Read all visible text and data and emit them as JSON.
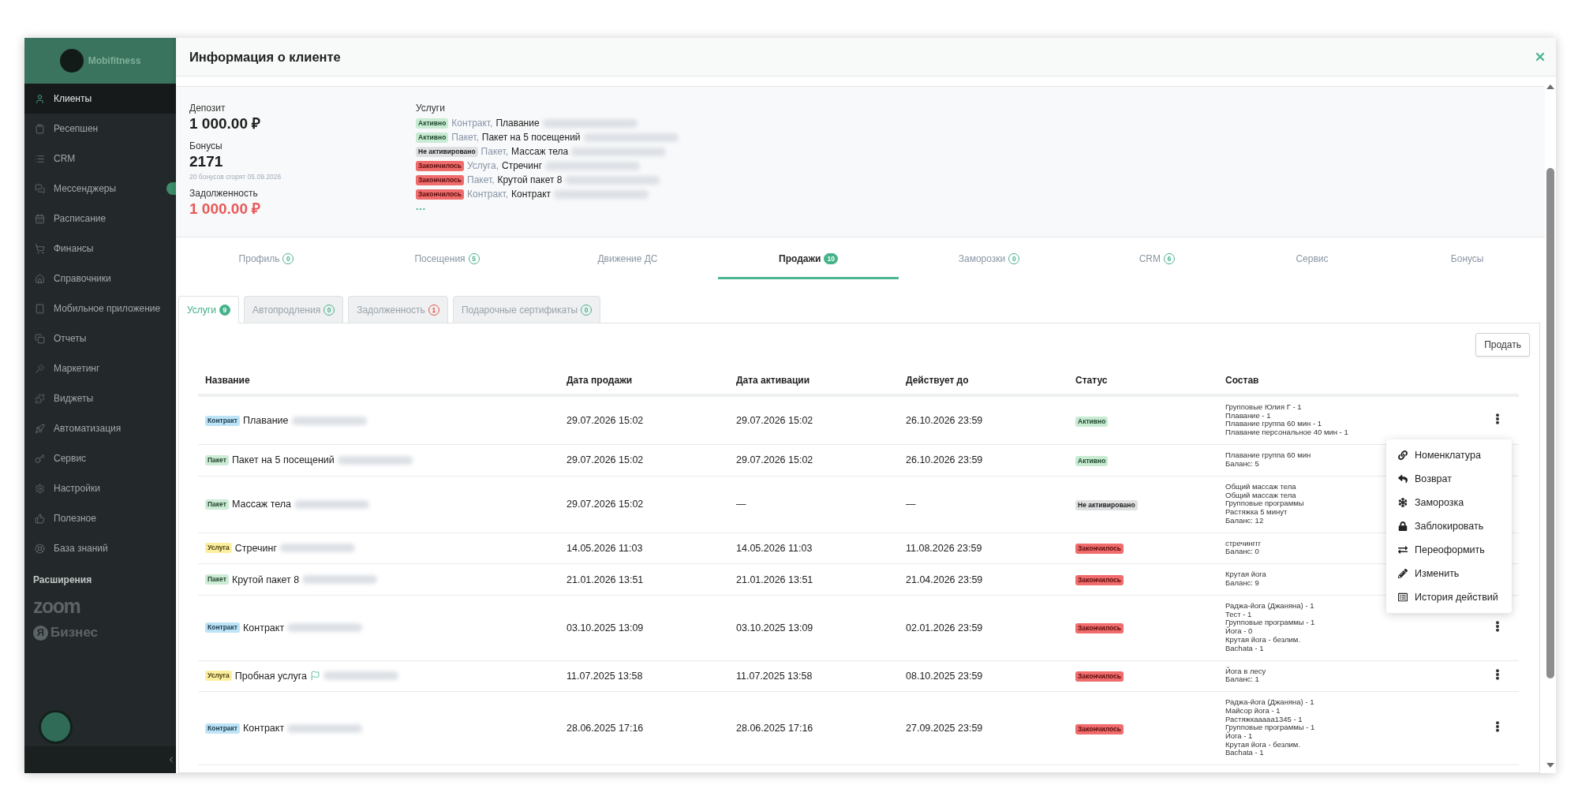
{
  "sidebar": {
    "logo": "Mobifitness",
    "items": [
      {
        "label": "Клиенты",
        "selected": true,
        "badge": false
      },
      {
        "label": "Ресепшен",
        "selected": false,
        "badge": false
      },
      {
        "label": "CRM",
        "selected": false,
        "badge": false
      },
      {
        "label": "Мессенджеры",
        "selected": false,
        "badge": true
      },
      {
        "label": "Расписание",
        "selected": false,
        "badge": false
      },
      {
        "label": "Финансы",
        "selected": false,
        "badge": false
      },
      {
        "label": "Справочники",
        "selected": false,
        "badge": false
      },
      {
        "label": "Мобильное приложение",
        "selected": false,
        "badge": false
      },
      {
        "label": "Отчеты",
        "selected": false,
        "badge": false
      },
      {
        "label": "Маркетинг",
        "selected": false,
        "badge": false
      },
      {
        "label": "Виджеты",
        "selected": false,
        "badge": false
      },
      {
        "label": "Автоматизация",
        "selected": false,
        "badge": false
      },
      {
        "label": "Сервис",
        "selected": false,
        "badge": false
      },
      {
        "label": "Настройки",
        "selected": false,
        "badge": false
      },
      {
        "label": "Полезное",
        "selected": false,
        "badge": false
      },
      {
        "label": "База знаний",
        "selected": false,
        "badge": false
      }
    ],
    "section": "Расширения",
    "extensions": [
      {
        "kind": "zoom",
        "label": "zoom"
      },
      {
        "kind": "yandex",
        "mark": "Я",
        "label": "Бизнес"
      }
    ]
  },
  "modal": {
    "title": "Информация о клиенте"
  },
  "summary": {
    "deposit": {
      "label": "Депозит",
      "value": "1 000.00 ₽"
    },
    "bonuses": {
      "label": "Бонусы",
      "value": "2171",
      "note": "20 бонусов сгорят 05.09.2026"
    },
    "debt": {
      "label": "Задолженность",
      "value": "1 000.00 ₽"
    },
    "services": {
      "label": "Услуги",
      "items": [
        {
          "status": {
            "label": "Активно",
            "kind": "active"
          },
          "type": "Контракт,",
          "name": "Плавание",
          "redacted": true
        },
        {
          "status": {
            "label": "Активно",
            "kind": "active"
          },
          "type": "Пакет,",
          "name": "Пакет на 5 посещений",
          "redacted": true
        },
        {
          "status": {
            "label": "Не активировано",
            "kind": "inactive"
          },
          "type": "Пакет,",
          "name": "Массаж тела",
          "redacted": true
        },
        {
          "status": {
            "label": "Закончилось",
            "kind": "expired"
          },
          "type": "Услуга,",
          "name": "Стречинг",
          "redacted": true
        },
        {
          "status": {
            "label": "Закончилось",
            "kind": "expired"
          },
          "type": "Пакет,",
          "name": "Крутой пакет 8",
          "redacted": true
        },
        {
          "status": {
            "label": "Закончилось",
            "kind": "expired"
          },
          "type": "Контракт,",
          "name": "Контракт",
          "redacted": true
        }
      ],
      "more": "..."
    }
  },
  "tabs": [
    {
      "label": "Профиль",
      "count": "0",
      "selected": false
    },
    {
      "label": "Посещения",
      "count": "5",
      "selected": false
    },
    {
      "label": "Движение ДС",
      "selected": false
    },
    {
      "label": "Продажи",
      "count": "10",
      "selected": true
    },
    {
      "label": "Заморозки",
      "count": "0",
      "selected": false
    },
    {
      "label": "CRM",
      "count": "6",
      "selected": false
    },
    {
      "label": "Сервис",
      "selected": false
    },
    {
      "label": "Бонусы",
      "selected": false
    }
  ],
  "sub_tabs": [
    {
      "label": "Услуги",
      "count": "9",
      "color": "#45b389",
      "selected": true
    },
    {
      "label": "Автопродления",
      "count": "0",
      "color": "#45b389",
      "selected": false
    },
    {
      "label": "Задолженность",
      "count": "1",
      "color": "#e5534b",
      "selected": false
    },
    {
      "label": "Подарочные сертификаты",
      "count": "0",
      "color": "#45b389",
      "selected": false
    }
  ],
  "sell_button": "Продать",
  "table": {
    "columns": [
      "Название",
      "Дата продажи",
      "Дата активации",
      "Действует до",
      "Статус",
      "Состав"
    ],
    "rows": [
      {
        "tag": {
          "label": "Контракт",
          "kind": "contract"
        },
        "name": "Плавание",
        "flag": false,
        "redacted": true,
        "sold": "29.07.2026 15:02",
        "activated": "29.07.2026 15:02",
        "valid_until": "26.10.2026 23:59",
        "status": {
          "label": "Активно",
          "kind": "active"
        },
        "contents": [
          "Групповые Юлия Г - 1",
          "Плавание - 1",
          "Плавание группа 60 мин - 1",
          "Плавание персональное 40 мин - 1"
        ],
        "menu_open": true
      },
      {
        "tag": {
          "label": "Пакет",
          "kind": "package"
        },
        "name": "Пакет на 5 посещений",
        "flag": false,
        "redacted": true,
        "sold": "29.07.2026 15:02",
        "activated": "29.07.2026 15:02",
        "valid_until": "26.10.2026 23:59",
        "status": {
          "label": "Активно",
          "kind": "active"
        },
        "contents": [
          "Плавание группа 60 мин",
          "Баланс: 5"
        ],
        "menu_open": false
      },
      {
        "tag": {
          "label": "Пакет",
          "kind": "package"
        },
        "name": "Массаж тела",
        "flag": false,
        "redacted": true,
        "sold": "29.07.2026 15:02",
        "activated": "—",
        "valid_until": "—",
        "status": {
          "label": "Не активировано",
          "kind": "inactive"
        },
        "contents": [
          "Общий массаж тела",
          "Общий массаж тела",
          "Групповые программы",
          "Растяжка 5 минут",
          "Баланс: 12"
        ],
        "menu_open": false
      },
      {
        "tag": {
          "label": "Услуга",
          "kind": "service"
        },
        "name": "Стречинг",
        "flag": false,
        "redacted": true,
        "sold": "14.05.2026 11:03",
        "activated": "14.05.2026 11:03",
        "valid_until": "11.08.2026 23:59",
        "status": {
          "label": "Закончилось",
          "kind": "expired"
        },
        "contents": [
          "стречинггг",
          "Баланс: 0"
        ],
        "menu_open": false
      },
      {
        "tag": {
          "label": "Пакет",
          "kind": "package"
        },
        "name": "Крутой пакет 8",
        "flag": false,
        "redacted": true,
        "sold": "21.01.2026 13:51",
        "activated": "21.01.2026 13:51",
        "valid_until": "21.04.2026 23:59",
        "status": {
          "label": "Закончилось",
          "kind": "expired"
        },
        "contents": [
          "Крутая йога",
          "Баланс: 9"
        ],
        "menu_open": false
      },
      {
        "tag": {
          "label": "Контракт",
          "kind": "contract"
        },
        "name": "Контракт",
        "flag": false,
        "redacted": true,
        "sold": "03.10.2025 13:09",
        "activated": "03.10.2025 13:09",
        "valid_until": "02.01.2026 23:59",
        "status": {
          "label": "Закончилось",
          "kind": "expired"
        },
        "contents": [
          "Раджа-йога (Джаняна) - 1",
          "Тест - 1",
          "Групповые программы - 1",
          "Йога - 0",
          "Крутая йога - безлим.",
          "Bachata - 1"
        ],
        "menu_open": false
      },
      {
        "tag": {
          "label": "Услуга",
          "kind": "service"
        },
        "name": "Пробная услуга",
        "flag": true,
        "redacted": true,
        "sold": "11.07.2025 13:58",
        "activated": "11.07.2025 13:58",
        "valid_until": "08.10.2025 23:59",
        "status": {
          "label": "Закончилось",
          "kind": "expired"
        },
        "contents": [
          "Йога в лесу",
          "Баланс: 1"
        ],
        "menu_open": false
      },
      {
        "tag": {
          "label": "Контракт",
          "kind": "contract"
        },
        "name": "Контракт",
        "flag": false,
        "redacted": true,
        "sold": "28.06.2025 17:16",
        "activated": "28.06.2025 17:16",
        "valid_until": "27.09.2025 23:59",
        "status": {
          "label": "Закончилось",
          "kind": "expired"
        },
        "contents": [
          "Раджа-йога (Джаняна) - 1",
          "Майсор йога - 1",
          "Растяжкааааа1345 - 1",
          "Групповые программы - 1",
          "Йога - 1",
          "Крутая йога - безлим.",
          "Bachata - 1"
        ],
        "menu_open": false
      }
    ]
  },
  "context_menu": {
    "items": [
      "Номенклатура",
      "Возврат",
      "Заморозка",
      "Заблокировать",
      "Переоформить",
      "Изменить",
      "История действий"
    ]
  }
}
